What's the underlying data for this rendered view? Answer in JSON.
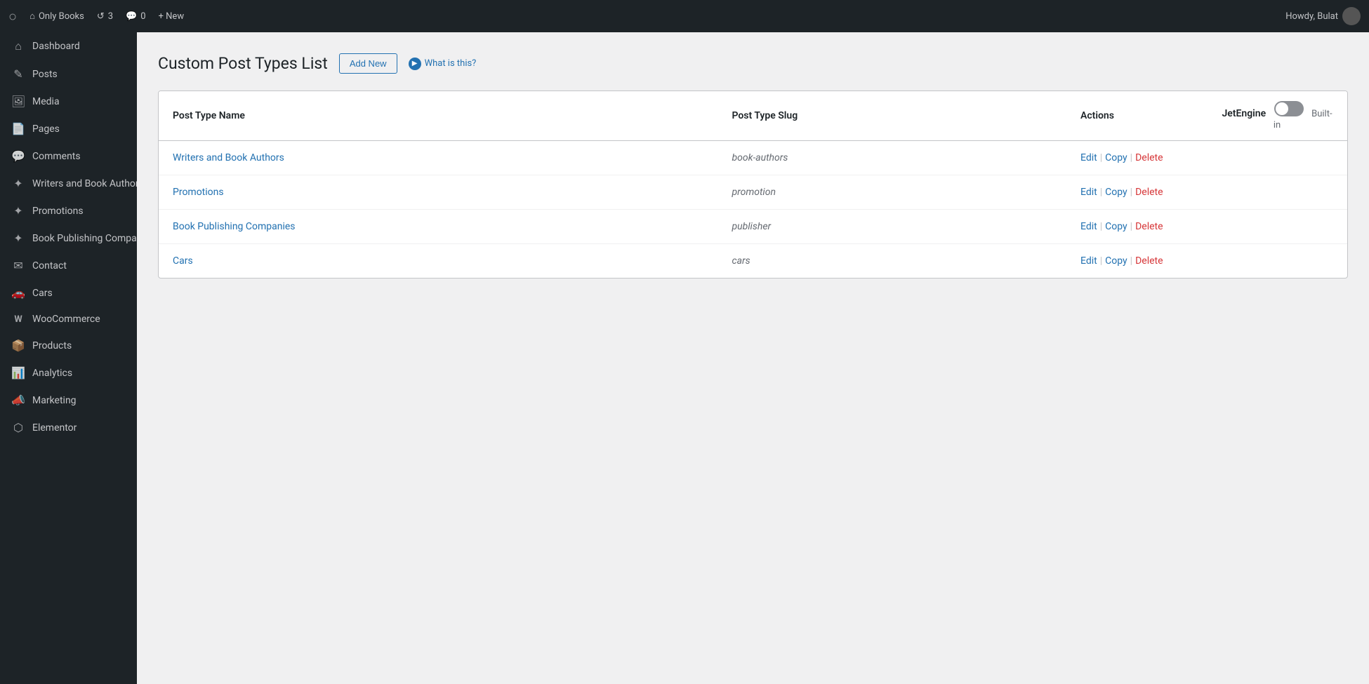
{
  "adminbar": {
    "logo": "⊞",
    "site_name": "Only Books",
    "updates_count": "3",
    "comments_count": "0",
    "new_label": "+ New",
    "howdy_text": "Howdy, Bulat"
  },
  "sidebar": {
    "items": [
      {
        "id": "dashboard",
        "label": "Dashboard",
        "icon": "⌂"
      },
      {
        "id": "posts",
        "label": "Posts",
        "icon": "✎"
      },
      {
        "id": "media",
        "label": "Media",
        "icon": "🖼"
      },
      {
        "id": "pages",
        "label": "Pages",
        "icon": "📄"
      },
      {
        "id": "comments",
        "label": "Comments",
        "icon": "💬"
      },
      {
        "id": "writers",
        "label": "Writers and Book Authors",
        "icon": "✦"
      },
      {
        "id": "promotions",
        "label": "Promotions",
        "icon": "✦"
      },
      {
        "id": "book-publishing",
        "label": "Book Publishing Companies",
        "icon": "✦"
      },
      {
        "id": "contact",
        "label": "Contact",
        "icon": "✉"
      },
      {
        "id": "cars",
        "label": "Cars",
        "icon": "🚗"
      },
      {
        "id": "woocommerce",
        "label": "WooCommerce",
        "icon": "W"
      },
      {
        "id": "products",
        "label": "Products",
        "icon": "📦"
      },
      {
        "id": "analytics",
        "label": "Analytics",
        "icon": "📊"
      },
      {
        "id": "marketing",
        "label": "Marketing",
        "icon": "📣"
      },
      {
        "id": "elementor",
        "label": "Elementor",
        "icon": "⬡"
      }
    ]
  },
  "page": {
    "title": "Custom Post Types List",
    "add_new_label": "Add New",
    "what_is_this_label": "What is this?"
  },
  "table": {
    "headers": {
      "post_type_name": "Post Type Name",
      "post_type_slug": "Post Type Slug",
      "actions": "Actions",
      "jetengine": "JetEngine",
      "built_in": "Built-in"
    },
    "rows": [
      {
        "name": "Writers and Book Authors",
        "slug": "book-authors",
        "actions": [
          "Edit",
          "Copy",
          "Delete"
        ]
      },
      {
        "name": "Promotions",
        "slug": "promotion",
        "actions": [
          "Edit",
          "Copy",
          "Delete"
        ]
      },
      {
        "name": "Book Publishing Companies",
        "slug": "publisher",
        "actions": [
          "Edit",
          "Copy",
          "Delete"
        ]
      },
      {
        "name": "Cars",
        "slug": "cars",
        "actions": [
          "Edit",
          "Copy",
          "Delete"
        ]
      }
    ],
    "action_labels": {
      "edit": "Edit",
      "copy": "Copy",
      "delete": "Delete"
    },
    "separator": "|"
  }
}
